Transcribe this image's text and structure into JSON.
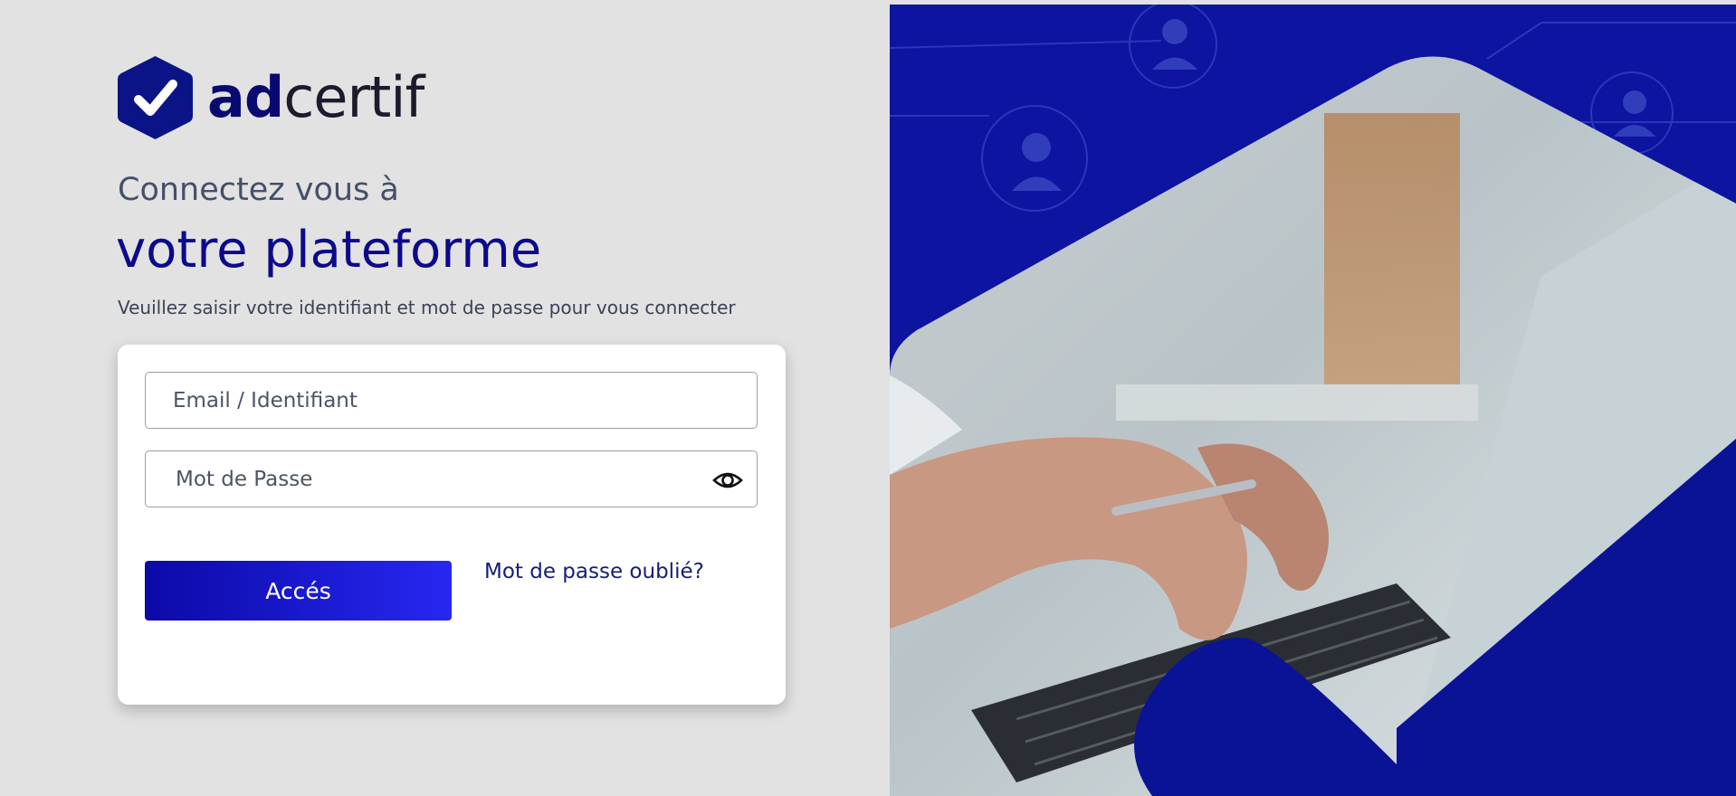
{
  "brand": {
    "name_bold": "ad",
    "name_light": "certif",
    "logo_icon": "check-hexagon-icon",
    "color": "#080a72"
  },
  "intro": {
    "line1": "Connectez vous à",
    "line2": "votre plateforme",
    "instructions": "Veuillez saisir votre identifiant et mot de passe pour vous connecter"
  },
  "form": {
    "email_placeholder": "Email / Identifiant",
    "password_placeholder": "Mot de Passe",
    "toggle_icon": "eye-icon",
    "submit_label": "Accés",
    "forgot_label": "Mot de passe oublié?"
  },
  "colors": {
    "accent": "#0b0aa6",
    "accent_light": "#2727f2",
    "background": "#e2e2e2",
    "hero_blue": "#0c14a0"
  },
  "hero": {
    "description_icon": "user-network-icons",
    "illustration": "hands-typing-on-laptop"
  }
}
